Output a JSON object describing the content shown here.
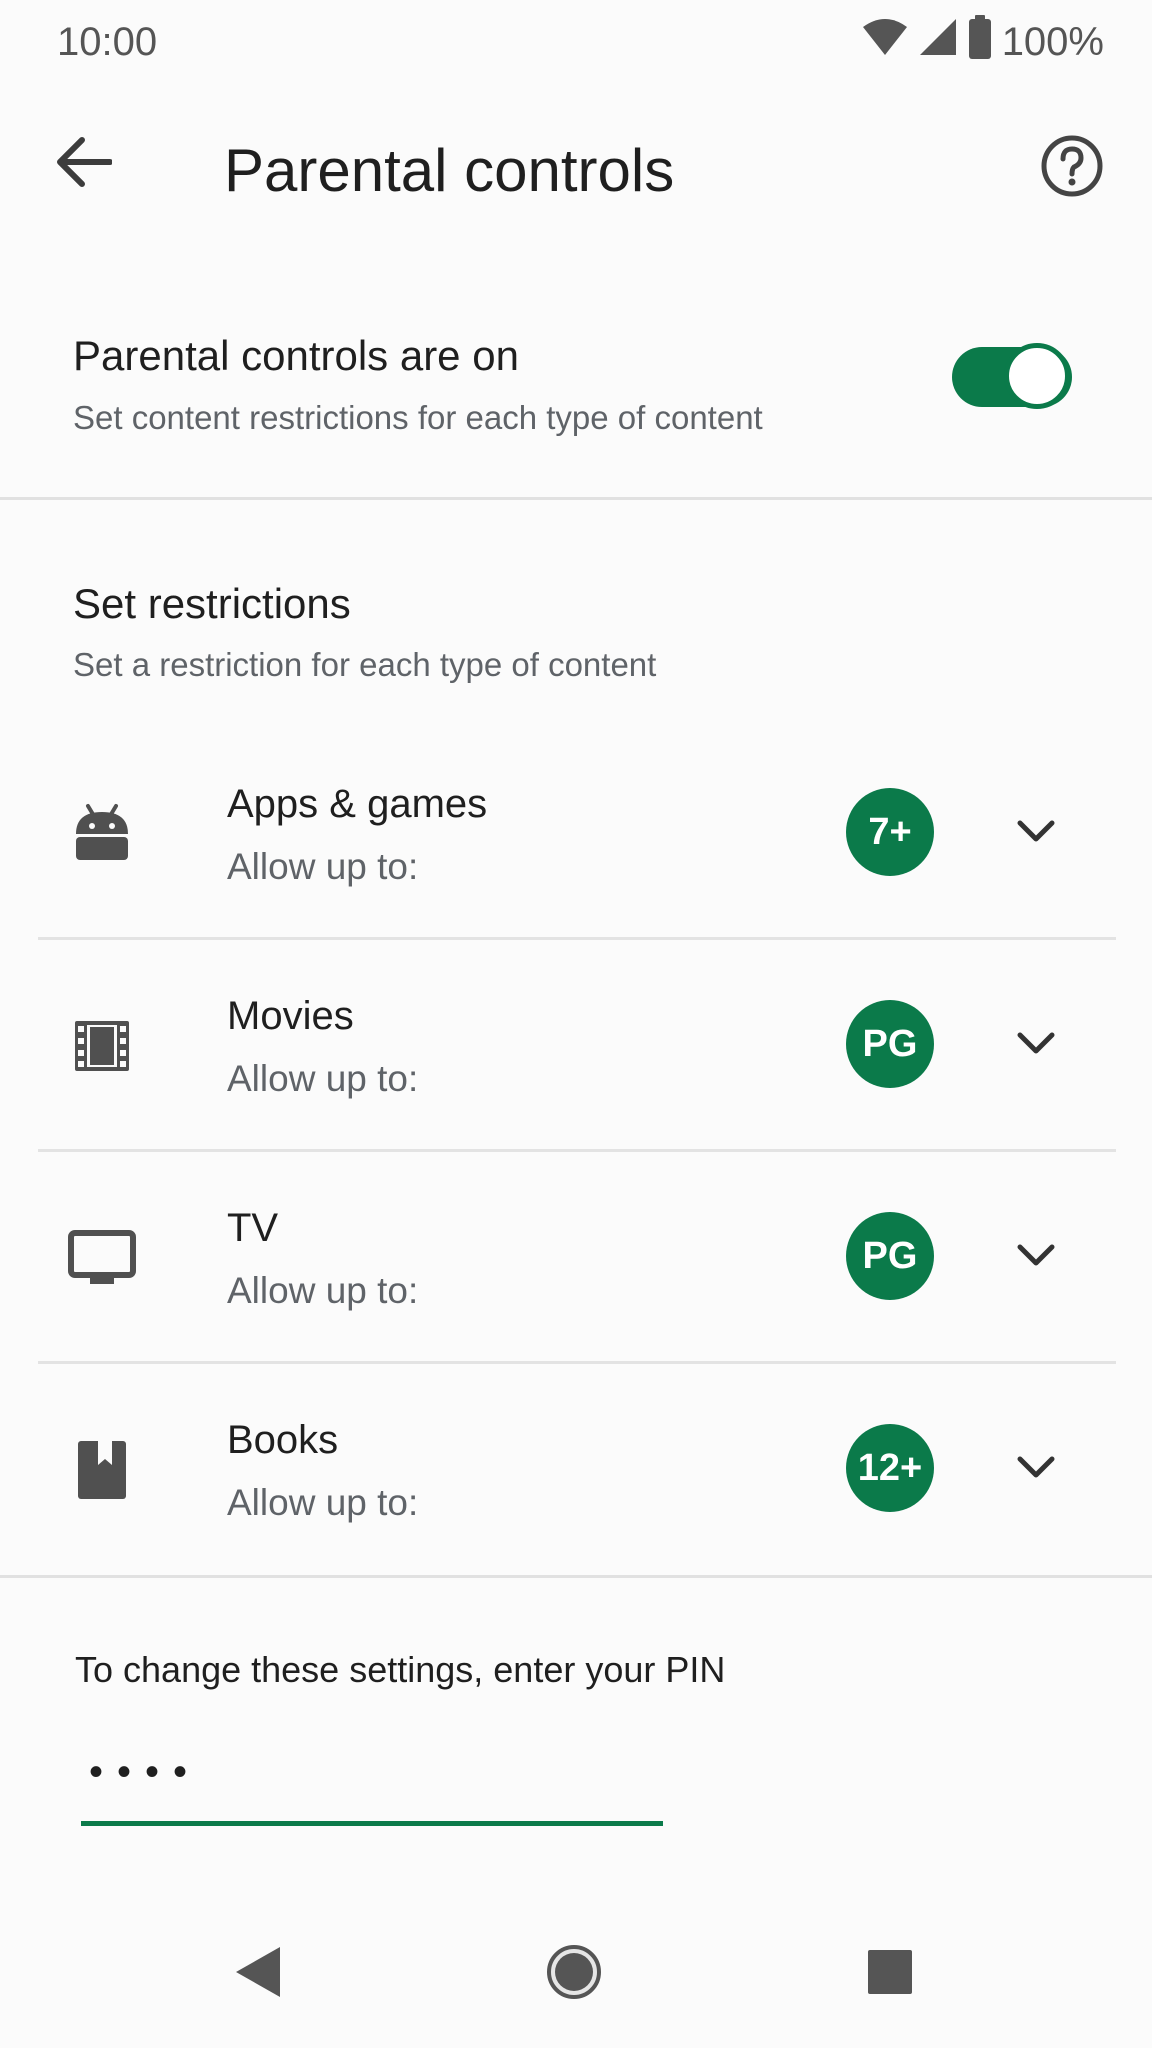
{
  "status_bar": {
    "time": "10:00",
    "battery": "100%",
    "icons": [
      "wifi-icon",
      "signal-icon",
      "battery-icon"
    ]
  },
  "app_bar": {
    "title": "Parental controls",
    "back_icon": "arrow-back-icon",
    "help_icon": "help-circle-icon"
  },
  "parental_controls": {
    "title": "Parental controls are on",
    "subtitle": "Set content restrictions for each type of content",
    "enabled": true
  },
  "restrictions": {
    "title": "Set restrictions",
    "subtitle": "Set a restriction for each type of content",
    "items": [
      {
        "label": "Apps & games",
        "sub": "Allow up to:",
        "rating": "7+",
        "icon": "android-icon"
      },
      {
        "label": "Movies",
        "sub": "Allow up to:",
        "rating": "PG",
        "icon": "film-icon"
      },
      {
        "label": "TV",
        "sub": "Allow up to:",
        "rating": "PG",
        "icon": "tv-icon"
      },
      {
        "label": "Books",
        "sub": "Allow up to:",
        "rating": "12+",
        "icon": "book-icon"
      }
    ]
  },
  "pin": {
    "label": "To change these settings, enter your PIN",
    "value": "••••"
  },
  "colors": {
    "accent": "#0b7a4a",
    "text_primary": "#1f1f1f",
    "text_secondary": "#5f6368",
    "icon": "#505050"
  },
  "nav_bar": {
    "icons": [
      "nav-back-icon",
      "nav-home-icon",
      "nav-recents-icon"
    ]
  }
}
